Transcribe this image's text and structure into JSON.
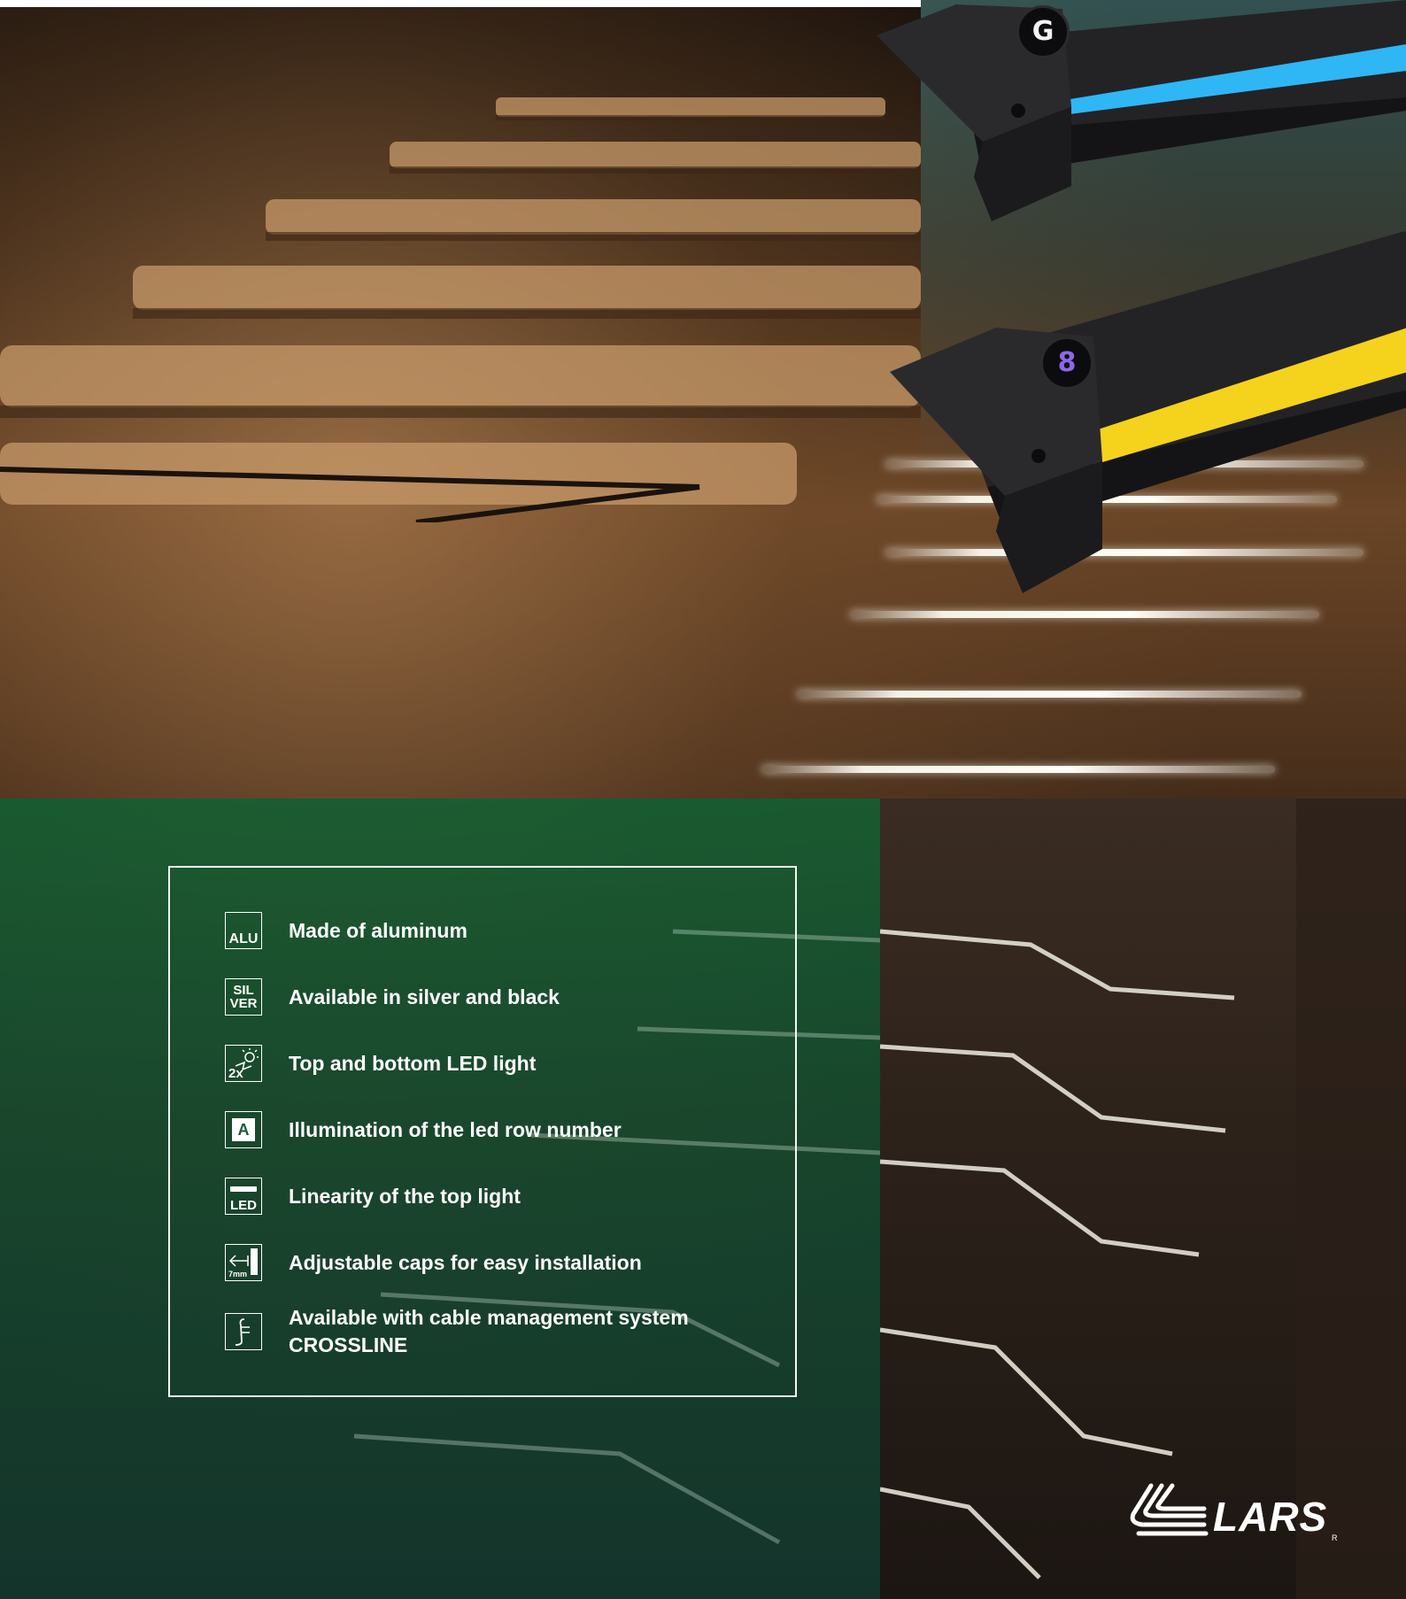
{
  "features": [
    {
      "icon": "alu-icon",
      "icon_text": "ALU",
      "text": "Made of aluminum"
    },
    {
      "icon": "silver-icon",
      "icon_text_top": "SIL",
      "icon_text_bottom": "VER",
      "text": "Available in silver and black"
    },
    {
      "icon": "dual-led-icon",
      "icon_text": "2x",
      "text": "Top and bottom LED light"
    },
    {
      "icon": "row-letter-icon",
      "icon_text": "A",
      "text": "Illumination of the led row number"
    },
    {
      "icon": "led-linearity-icon",
      "icon_text": "LED",
      "text": "Linearity of the top light"
    },
    {
      "icon": "adjustable-cap-icon",
      "icon_text": "7mm",
      "text": "Adjustable caps for easy installation"
    },
    {
      "icon": "cable-management-icon",
      "text": "Available with cable management system",
      "text_line2": "CROSSLINE"
    }
  ],
  "products": [
    {
      "name": "blue-led-profile",
      "badge": "G",
      "light_color": "#2fb6f5",
      "badge_color": "#f2f2f2"
    },
    {
      "name": "yellow-led-profile",
      "badge": "8",
      "light_color": "#f5d21c",
      "badge_color": "#8e67e8"
    }
  ],
  "brand": {
    "logo_text": "LARS",
    "registered_mark": "R"
  },
  "colors": {
    "panel_green": "#125f32",
    "frame": "#ffffff"
  }
}
